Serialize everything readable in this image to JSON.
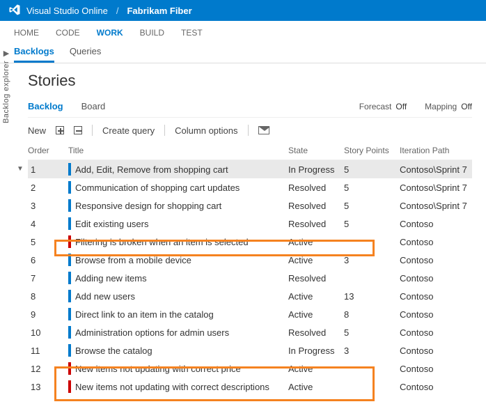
{
  "header": {
    "product": "Visual Studio Online",
    "project": "Fabrikam Fiber"
  },
  "hubs": [
    "HOME",
    "CODE",
    "WORK",
    "BUILD",
    "TEST"
  ],
  "activeHub": "WORK",
  "subtabs": [
    "Backlogs",
    "Queries"
  ],
  "activeSubtab": "Backlogs",
  "sideRail": "Backlog explorer",
  "pageTitle": "Stories",
  "midTabs": [
    "Backlog",
    "Board"
  ],
  "activeMid": "Backlog",
  "forecast": {
    "label": "Forecast",
    "value": "Off"
  },
  "mapping": {
    "label": "Mapping",
    "value": "Off"
  },
  "toolbar": {
    "new": "New",
    "createQuery": "Create query",
    "columnOptions": "Column options"
  },
  "columns": {
    "order": "Order",
    "title": "Title",
    "state": "State",
    "storyPoints": "Story Points",
    "iterationPath": "Iteration Path"
  },
  "rows": [
    {
      "order": "1",
      "kind": "story",
      "title": "Add, Edit, Remove from shopping cart",
      "state": "In Progress",
      "sp": "5",
      "iter": "Contoso\\Sprint 7",
      "selected": true
    },
    {
      "order": "2",
      "kind": "story",
      "title": "Communication of shopping cart updates",
      "state": "Resolved",
      "sp": "5",
      "iter": "Contoso\\Sprint 7"
    },
    {
      "order": "3",
      "kind": "story",
      "title": "Responsive design for shopping cart",
      "state": "Resolved",
      "sp": "5",
      "iter": "Contoso\\Sprint 7"
    },
    {
      "order": "4",
      "kind": "story",
      "title": "Edit existing users",
      "state": "Resolved",
      "sp": "5",
      "iter": "Contoso"
    },
    {
      "order": "5",
      "kind": "bug",
      "title": "Filtering is broken when an item is selected",
      "state": "Active",
      "sp": "",
      "iter": "Contoso"
    },
    {
      "order": "6",
      "kind": "story",
      "title": "Browse from a mobile device",
      "state": "Active",
      "sp": "3",
      "iter": "Contoso"
    },
    {
      "order": "7",
      "kind": "story",
      "title": "Adding new items",
      "state": "Resolved",
      "sp": "",
      "iter": "Contoso"
    },
    {
      "order": "8",
      "kind": "story",
      "title": "Add new users",
      "state": "Active",
      "sp": "13",
      "iter": "Contoso"
    },
    {
      "order": "9",
      "kind": "story",
      "title": "Direct link to an item in the catalog",
      "state": "Active",
      "sp": "8",
      "iter": "Contoso"
    },
    {
      "order": "10",
      "kind": "story",
      "title": "Administration options for admin users",
      "state": "Resolved",
      "sp": "5",
      "iter": "Contoso"
    },
    {
      "order": "11",
      "kind": "story",
      "title": "Browse the catalog",
      "state": "In Progress",
      "sp": "3",
      "iter": "Contoso"
    },
    {
      "order": "12",
      "kind": "bug",
      "title": "New items not updating with correct price",
      "state": "Active",
      "sp": "",
      "iter": "Contoso"
    },
    {
      "order": "13",
      "kind": "bug",
      "title": "New items not updating with correct descriptions",
      "state": "Active",
      "sp": "",
      "iter": "Contoso"
    }
  ]
}
